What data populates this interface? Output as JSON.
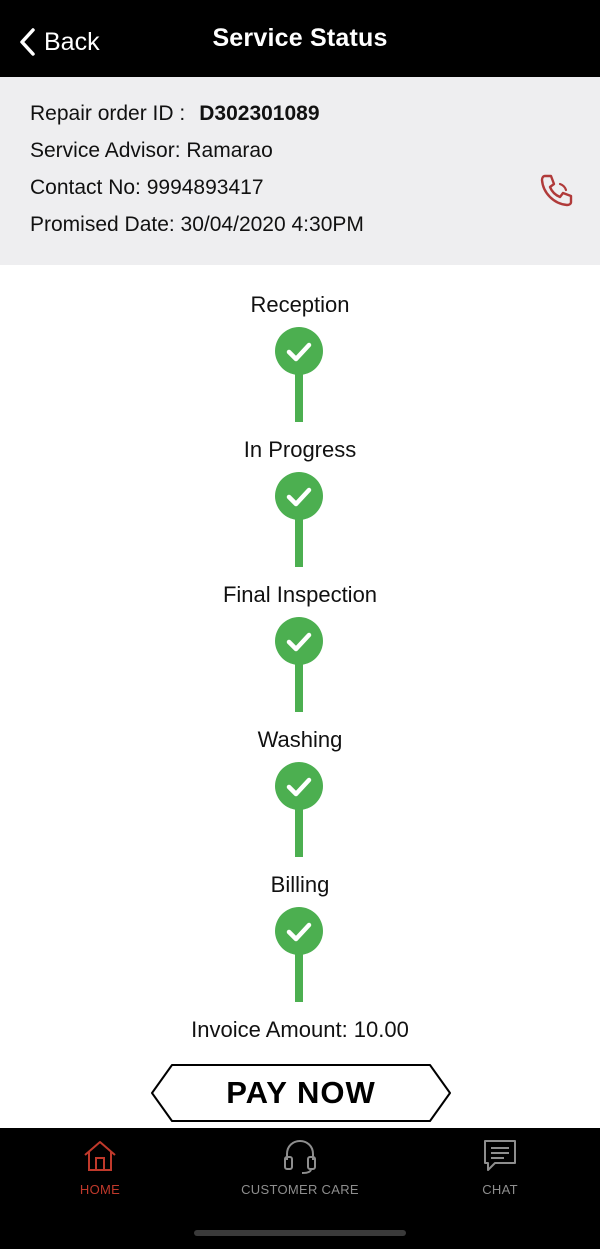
{
  "header": {
    "back_label": "Back",
    "title": "Service Status"
  },
  "info": {
    "repair_label": "Repair order ID :",
    "repair_value": "D302301089",
    "advisor": "Service Advisor: Ramarao",
    "contact": "Contact No: 9994893417",
    "promised": "Promised Date: 30/04/2020 4:30PM"
  },
  "steps": [
    {
      "label": "Reception",
      "status": "completed"
    },
    {
      "label": "In Progress",
      "status": "completed"
    },
    {
      "label": "Final Inspection",
      "status": "completed"
    },
    {
      "label": "Washing",
      "status": "completed"
    },
    {
      "label": "Billing",
      "status": "completed"
    }
  ],
  "invoice": {
    "text": "Invoice Amount: 10.00"
  },
  "pay_button": {
    "label": "PAY NOW"
  },
  "nav": {
    "items": [
      {
        "label": "HOME",
        "icon": "home-icon",
        "active": true
      },
      {
        "label": "CUSTOMER CARE",
        "icon": "headset-icon",
        "active": false
      },
      {
        "label": "CHAT",
        "icon": "chat-icon",
        "active": false
      }
    ]
  },
  "colors": {
    "header_bg": "#000000",
    "info_bg": "#eeeef0",
    "step_green": "#4caf50",
    "phone_icon": "#b03a3a",
    "nav_active": "#c0392b",
    "nav_inactive": "#8e8e8e"
  }
}
